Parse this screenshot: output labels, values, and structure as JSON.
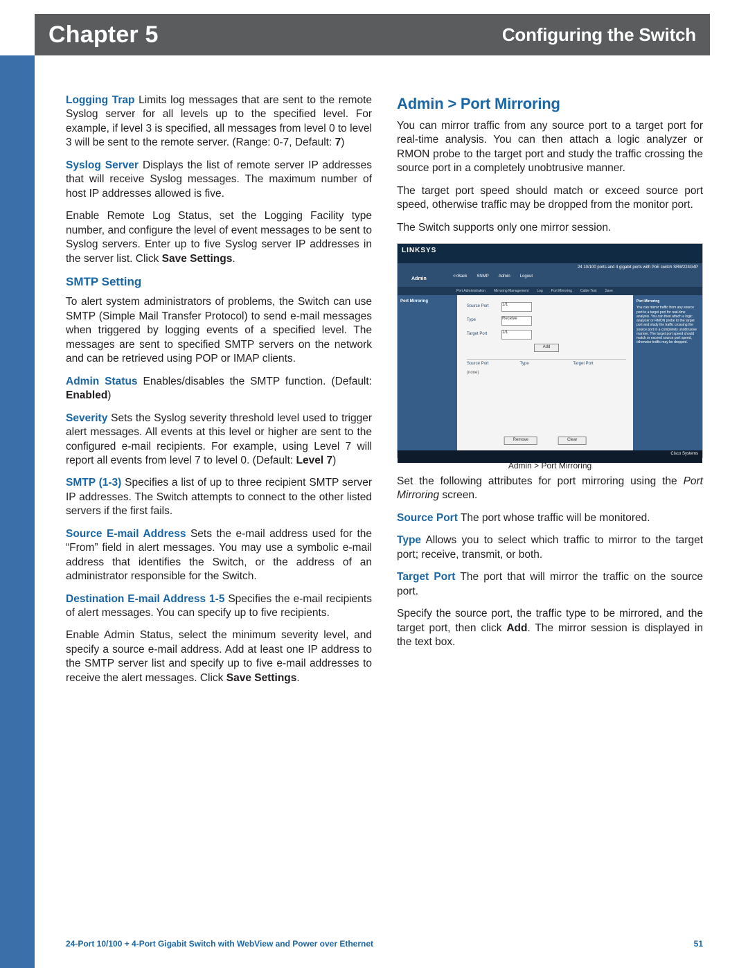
{
  "header": {
    "chapter": "Chapter 5",
    "section": "Configuring the Switch"
  },
  "left": {
    "logging_trap": {
      "label": "Logging Trap",
      "text": "  Limits log messages that are sent to the remote Syslog server for all levels up to the specified level. For example, if level 3 is specified, all messages from level 0 to level 3 will be sent to the remote server. (Range: 0-7, Default: ",
      "default_bold": "7",
      "tail": ")"
    },
    "syslog_server": {
      "label": "Syslog Server",
      "text": " Displays the list of remote server IP addresses that will receive Syslog messages. The maximum number of host IP addresses allowed is five."
    },
    "enable_remote": {
      "pre": "Enable Remote Log Status, set the Logging Facility type number, and configure the level of event messages to be sent to Syslog servers. Enter up to five Syslog server IP addresses in the server list. Click ",
      "bold": "Save Settings",
      "post": "."
    },
    "smtp_heading": "SMTP Setting",
    "smtp_intro": "To alert system administrators of problems, the Switch can use SMTP (Simple Mail Transfer Protocol) to send e-mail messages when triggered by logging events of a specified level. The messages are sent to specified SMTP servers on the network and can be retrieved using POP or IMAP clients.",
    "admin_status": {
      "label": "Admin Status",
      "text": " Enables/disables the SMTP function. (Default: ",
      "default_bold": "Enabled",
      "tail": ")"
    },
    "severity": {
      "label": "Severity",
      "text": "  Sets the Syslog severity threshold level used to trigger alert messages. All events at this level or higher are sent to the configured e-mail recipients. For example, using Level 7 will report all events from level 7 to level 0. (Default: ",
      "default_bold": "Level 7",
      "tail": ")"
    },
    "smtp13": {
      "label": "SMTP (1-3)",
      "text": "  Specifies a list of up to three recipient SMTP server IP addresses. The Switch attempts to connect to the other listed servers if the first fails."
    },
    "src_email": {
      "label": "Source E-mail Address",
      "text": "  Sets the e-mail address used for the “From” field in alert messages. You may use a symbolic e-mail address that identifies the Switch, or the address of an administrator responsible for the Switch."
    },
    "dest_email": {
      "label": "Destination E-mail Address 1-5",
      "text": " Specifies the e-mail recipients of alert messages. You can specify up to five recipients."
    },
    "closing": {
      "pre": "Enable Admin Status, select the minimum severity level, and specify a source e-mail address. Add at least one IP address to the SMTP server list and specify up to five e-mail addresses to receive the alert messages. Click ",
      "bold": "Save Settings",
      "post": "."
    }
  },
  "right": {
    "heading": "Admin > Port Mirroring",
    "p1": "You can mirror traffic from any source port to a target port for real-time analysis. You can then attach a logic analyzer or RMON probe to the target port and study the traffic crossing the source port in a completely unobtrusive manner.",
    "p2": "The target port speed should match or exceed source port speed, otherwise traffic may be dropped from the monitor port.",
    "p3": "The Switch supports only one mirror session.",
    "caption": "Admin > Port Mirroring",
    "screenshot": {
      "brand": "LINKSYS",
      "product_line": "24 10/100 ports and 4 gigabit ports with PoE switch    SRW224G4P",
      "section": "Admin",
      "tabs": [
        "<<Back",
        "SNMP",
        "Admin",
        "Logout"
      ],
      "subnav": [
        "Port Administration",
        "Mirroring Management",
        "Log",
        "Port Mirroring",
        "Cable Test",
        "Save"
      ],
      "side_label": "Port Mirroring",
      "fields": {
        "source_port_label": "Source Port",
        "source_port_value": "1/1",
        "type_label": "Type",
        "type_value": "Receive",
        "target_port_label": "Target Port",
        "target_port_value": "1/1",
        "add_btn": "Add"
      },
      "table": {
        "h1": "Source Port",
        "h2": "Type",
        "h3": "Target Port",
        "row_blank": "(none)"
      },
      "buttons": {
        "remove": "Remove",
        "clear": "Clear"
      },
      "help_title": "Port Mirroring",
      "help_text": "You can mirror traffic from any source port to a target port for real-time analysis. You can then attach a logic analyzer or RMON probe to the target port and study the traffic crossing the source port in a completely unobtrusive manner. The target port speed should match or exceed source port speed, otherwise traffic may be dropped.",
      "cisco": "Cisco Systems"
    },
    "set_attrs": {
      "pre": "Set the following attributes for port mirroring using the ",
      "italic": "Port Mirroring",
      "post": " screen."
    },
    "source_port": {
      "label": "Source Port",
      "text": "  The port whose traffic will be monitored."
    },
    "type": {
      "label": "Type",
      "text": "  Allows you to select which traffic to mirror to the target port; receive, transmit, or both."
    },
    "target_port": {
      "label": "Target Port",
      "text": "  The port that will mirror the traffic on the source port."
    },
    "specify": {
      "pre": "Specify the source port, the traffic type to be mirrored, and the target port, then click ",
      "bold": "Add",
      "post": ". The mirror session is displayed in the text box."
    }
  },
  "footer": {
    "product": "24-Port 10/100 + 4-Port Gigabit Switch with WebView and Power over Ethernet",
    "page": "51"
  }
}
